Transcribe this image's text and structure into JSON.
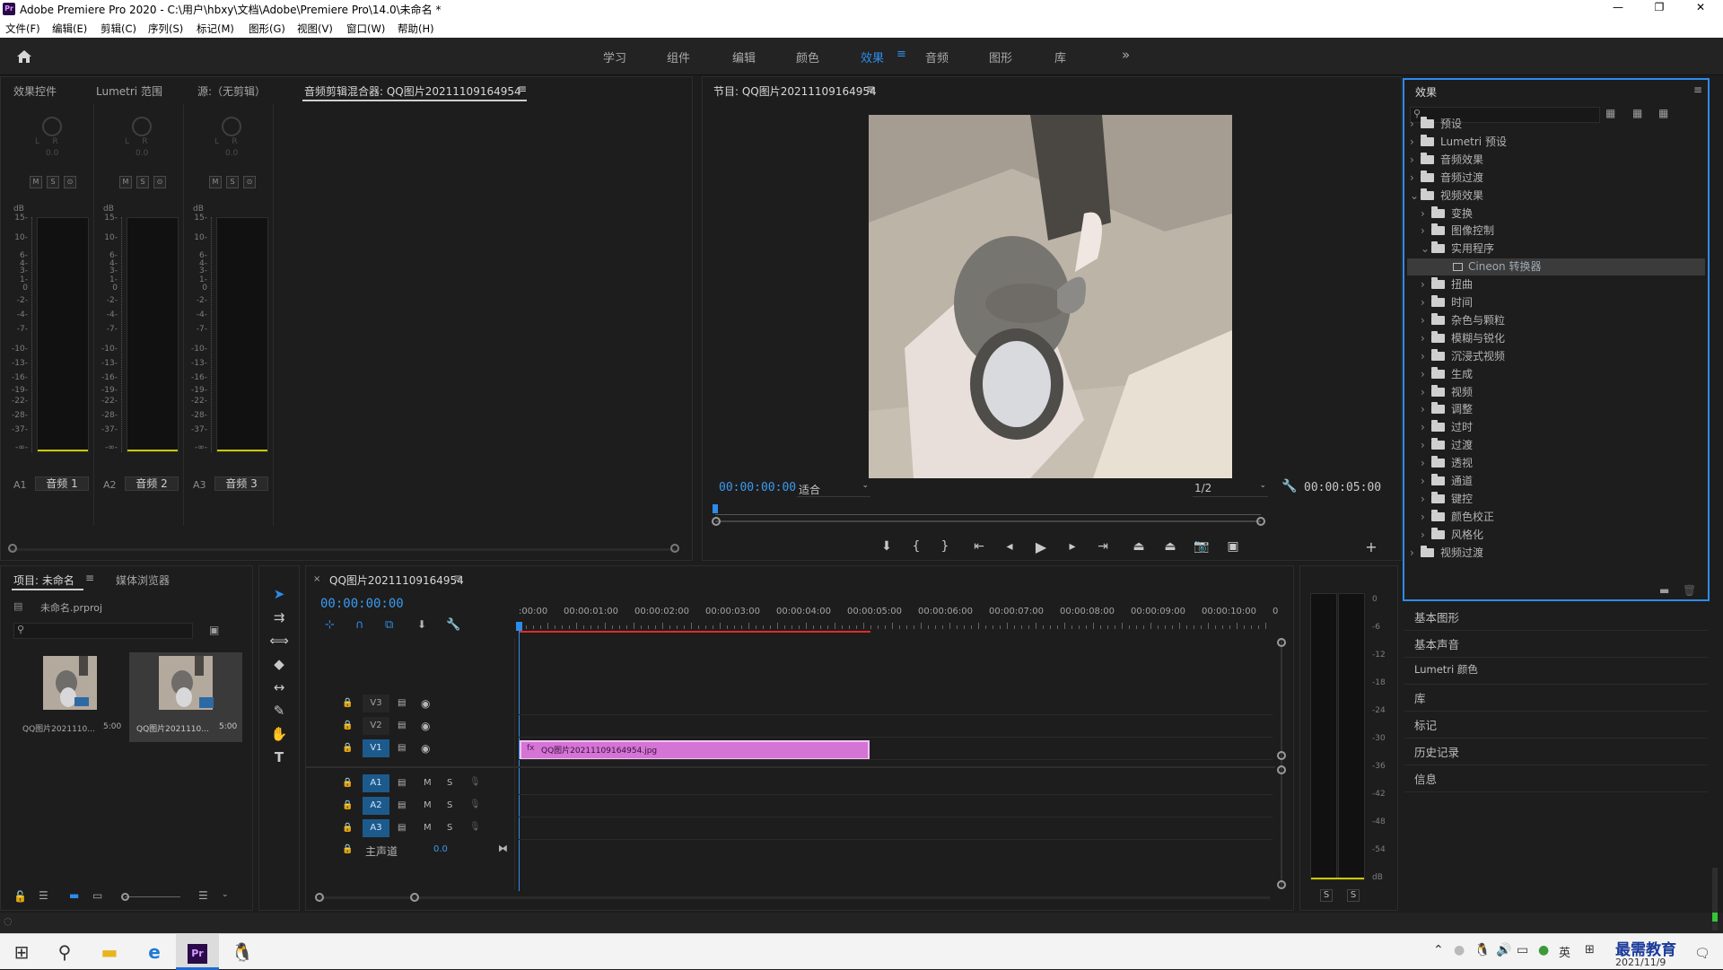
{
  "window": {
    "title": "Adobe Premiere Pro 2020 - C:\\用户\\hbxy\\文档\\Adobe\\Premiere Pro\\14.0\\未命名 *",
    "app_badge": "Pr",
    "minimize": "—",
    "maximize": "❐",
    "close": "✕"
  },
  "menu": [
    "文件(F)",
    "编辑(E)",
    "剪辑(C)",
    "序列(S)",
    "标记(M)",
    "图形(G)",
    "视图(V)",
    "窗口(W)",
    "帮助(H)"
  ],
  "workspaces": [
    "学习",
    "组件",
    "编辑",
    "颜色",
    "效果",
    "音频",
    "图形",
    "库"
  ],
  "workspace_active": "效果",
  "more": "»",
  "left_tabs": [
    "效果控件",
    "Lumetri 范围",
    "源:（无剪辑）",
    "音频剪辑混合器: QQ图片20211109164954"
  ],
  "mixer": {
    "db_label": "dB",
    "scale": [
      "15-",
      "10-",
      "6-",
      "4-",
      "3-",
      "1-",
      "0",
      "-2-",
      "-4-",
      "-7-",
      "-10-",
      "-13-",
      "-16-",
      "-19-",
      "-22-",
      "-28-",
      "-37-",
      "-∞-"
    ],
    "channels": [
      {
        "id": "A1",
        "name": "音频 1",
        "pan": "0.0",
        "lr": "L     R"
      },
      {
        "id": "A2",
        "name": "音频 2",
        "pan": "0.0",
        "lr": "L     R"
      },
      {
        "id": "A3",
        "name": "音频 3",
        "pan": "0.0",
        "lr": "L     R"
      }
    ],
    "msb": [
      "M",
      "S",
      "⊙"
    ]
  },
  "program": {
    "title": "节目: QQ图片20211109164954",
    "timecode_in": "00:00:00:00",
    "fit": "适合",
    "resolution": "1/2",
    "timecode_out": "00:00:05:00"
  },
  "effects": {
    "title": "效果",
    "items": [
      {
        "label": "预设",
        "level": 0,
        "open": false,
        "preset": true
      },
      {
        "label": "Lumetri 预设",
        "level": 0,
        "open": false,
        "preset": true
      },
      {
        "label": "音频效果",
        "level": 0,
        "open": false
      },
      {
        "label": "音频过渡",
        "level": 0,
        "open": false
      },
      {
        "label": "视频效果",
        "level": 0,
        "open": true
      },
      {
        "label": "变换",
        "level": 1,
        "open": false
      },
      {
        "label": "图像控制",
        "level": 1,
        "open": false
      },
      {
        "label": "实用程序",
        "level": 1,
        "open": true
      },
      {
        "label": "Cineon 转换器",
        "level": 2,
        "selected": true
      },
      {
        "label": "扭曲",
        "level": 1,
        "open": false
      },
      {
        "label": "时间",
        "level": 1,
        "open": false
      },
      {
        "label": "杂色与颗粒",
        "level": 1,
        "open": false
      },
      {
        "label": "模糊与锐化",
        "level": 1,
        "open": false
      },
      {
        "label": "沉浸式视频",
        "level": 1,
        "open": false
      },
      {
        "label": "生成",
        "level": 1,
        "open": false
      },
      {
        "label": "视频",
        "level": 1,
        "open": false
      },
      {
        "label": "调整",
        "level": 1,
        "open": false
      },
      {
        "label": "过时",
        "level": 1,
        "open": false
      },
      {
        "label": "过渡",
        "level": 1,
        "open": false
      },
      {
        "label": "透视",
        "level": 1,
        "open": false
      },
      {
        "label": "通道",
        "level": 1,
        "open": false
      },
      {
        "label": "键控",
        "level": 1,
        "open": false
      },
      {
        "label": "颜色校正",
        "level": 1,
        "open": false
      },
      {
        "label": "风格化",
        "level": 1,
        "open": false
      },
      {
        "label": "视频过渡",
        "level": 0,
        "open": false
      }
    ]
  },
  "right_panels": [
    "基本图形",
    "基本声音",
    "Lumetri 颜色",
    "库",
    "标记",
    "历史记录",
    "信息"
  ],
  "project": {
    "tabs": [
      "项目: 未命名",
      "媒体浏览器"
    ],
    "file": "未命名.prproj",
    "thumbs": [
      {
        "name": "QQ图片2021110...",
        "dur": "5:00"
      },
      {
        "name": "QQ图片2021110...",
        "dur": "5:00"
      }
    ]
  },
  "timeline": {
    "title": "QQ图片20211109164954",
    "timecode": "00:00:00:00",
    "ruler": [
      ":00:00",
      "00:00:01:00",
      "00:00:02:00",
      "00:00:03:00",
      "00:00:04:00",
      "00:00:05:00",
      "00:00:06:00",
      "00:00:07:00",
      "00:00:08:00",
      "00:00:09:00",
      "00:00:10:00",
      "0"
    ],
    "video_tracks": [
      "V3",
      "V2",
      "V1"
    ],
    "audio_tracks": [
      "A1",
      "A2",
      "A3"
    ],
    "master": "主声道",
    "master_val": "0.0",
    "clip": "QQ图片20211109164954.jpg",
    "track_m": "M",
    "track_s": "S"
  },
  "audio_meter": {
    "scale": [
      "0",
      "-6",
      "-12",
      "-18",
      "-24",
      "-30",
      "-36",
      "-42",
      "-48",
      "-54",
      "dB"
    ],
    "s1": "S",
    "s2": "S"
  },
  "taskbar": {
    "ime": "英",
    "date": "2021/11/9",
    "watermark": "最需教育"
  }
}
